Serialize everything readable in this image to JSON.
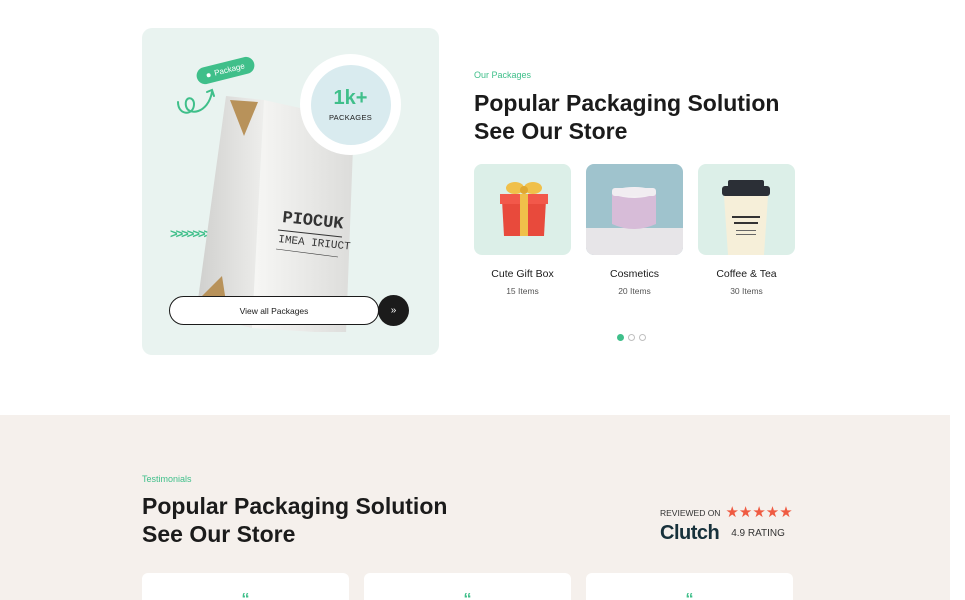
{
  "hero": {
    "tag_label": "Package",
    "badge_number": "1k+",
    "badge_label": "PACKAGES",
    "box_brand": "PIOCUK",
    "box_subtitle": "IMEA IRIUCT",
    "view_all_label": "View all Packages",
    "arrow_glyph": "»",
    "chevrons_glyph": ">>>>>>>"
  },
  "popular": {
    "eyebrow": "Our Packages",
    "title_line1": "Popular Packaging Solution",
    "title_line2": "See Our Store",
    "products": [
      {
        "name": "Cute Gift Box",
        "count": "15 Items"
      },
      {
        "name": "Cosmetics",
        "count": "20 Items"
      },
      {
        "name": "Coffee & Tea",
        "count": "30 Items"
      }
    ],
    "carousel": {
      "total": 3,
      "active": 1
    }
  },
  "testimonials": {
    "eyebrow": "Testimonials",
    "title_line1": "Popular Packaging Solution",
    "title_line2": "See Our Store",
    "reviewed_on": "REVIEWED ON",
    "stars": "★★★★★",
    "platform": "Clutch",
    "rating": "4.9 RATING",
    "quote_glyph": "“"
  },
  "colors": {
    "accent": "#3fbf8a",
    "dark": "#1b1b1b",
    "star": "#ef5b42",
    "hero_bg": "#e9f3f0",
    "testimonial_bg": "#f5f0ec"
  }
}
